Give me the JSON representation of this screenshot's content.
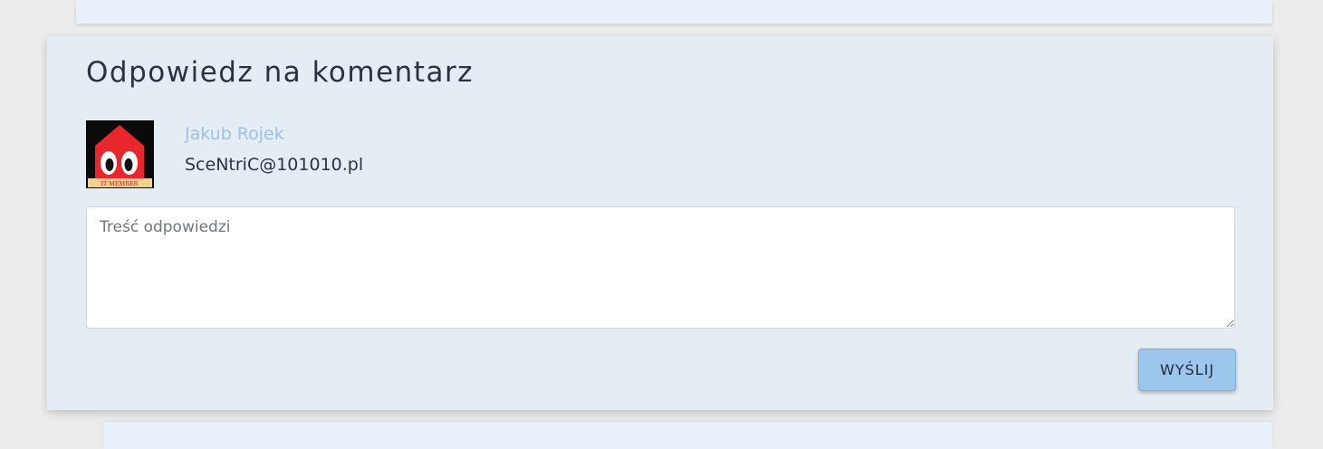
{
  "reply_form": {
    "title": "Odpowiedz na komentarz",
    "author": {
      "name": "Jakub Rojek",
      "email": "SceNtriC@101010.pl",
      "avatar_badge": "IT MEMBER"
    },
    "textarea": {
      "placeholder": "Treść odpowiedzi",
      "value": ""
    },
    "submit_label": "WYŚLIJ"
  },
  "colors": {
    "panel_bg": "#e4ecf4",
    "author_name": "#9fc2e0",
    "button_bg": "#9cc6ec",
    "avatar_red": "#e8262b"
  },
  "icons": {
    "top_card": "chevron-down-icon"
  }
}
